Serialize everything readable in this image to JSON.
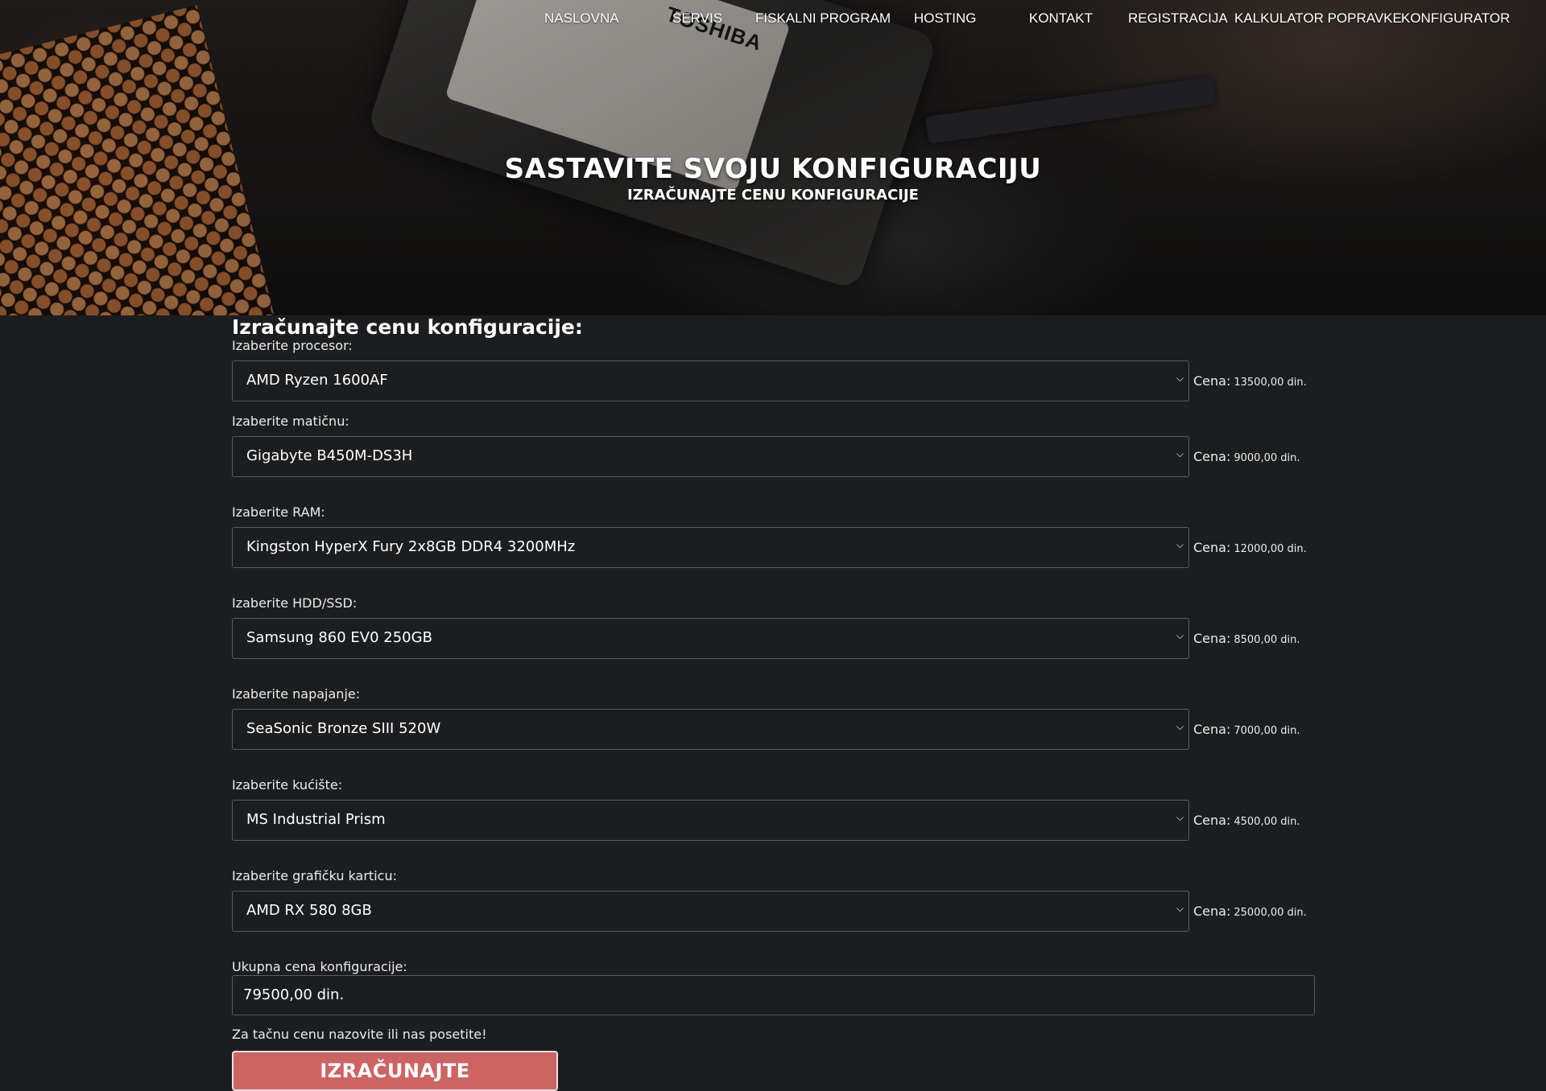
{
  "nav": {
    "items": [
      "NASLOVNA",
      "SERVIS",
      "FISKALNI PROGRAM",
      "HOSTING",
      "KONTAKT",
      "REGISTRACIJA",
      "KALKULATOR POPRAVKE",
      "KONFIGURATOR"
    ]
  },
  "hero": {
    "title": "SASTAVITE SVOJU KONFIGURACIJU",
    "subtitle": "IZRAČUNAJTE CENU KONFIGURACIJE",
    "drive_brand": "TOSHIBA"
  },
  "form": {
    "title": "Izračunajte cenu konfiguracije:",
    "price_label": "Cena:",
    "fields": [
      {
        "label": "Izaberite procesor:",
        "value": "AMD Ryzen 1600AF",
        "price": "13500,00 din."
      },
      {
        "label": "Izaberite matičnu:",
        "value": "Gigabyte B450M-DS3H",
        "price": "9000,00 din."
      },
      {
        "label": "Izaberite RAM:",
        "value": "Kingston HyperX Fury 2x8GB DDR4 3200MHz",
        "price": "12000,00 din."
      },
      {
        "label": "Izaberite HDD/SSD:",
        "value": "Samsung 860 EV0 250GB",
        "price": "8500,00 din."
      },
      {
        "label": "Izaberite napajanje:",
        "value": "SeaSonic Bronze SIII 520W",
        "price": "7000,00 din."
      },
      {
        "label": "Izaberite kućište:",
        "value": "MS Industrial Prism",
        "price": "4500,00 din."
      },
      {
        "label": "Izaberite grafičku karticu:",
        "value": "AMD RX 580 8GB",
        "price": "25000,00 din."
      }
    ],
    "total_label": "Ukupna cena konfiguracije:",
    "total_value": "79500,00 din.",
    "note": "Za tačnu cenu nazovite ili nas posetite!",
    "button_label": "IZRAČUNAJTE"
  },
  "icons": {
    "dropdown": "chevron-down-icon"
  }
}
